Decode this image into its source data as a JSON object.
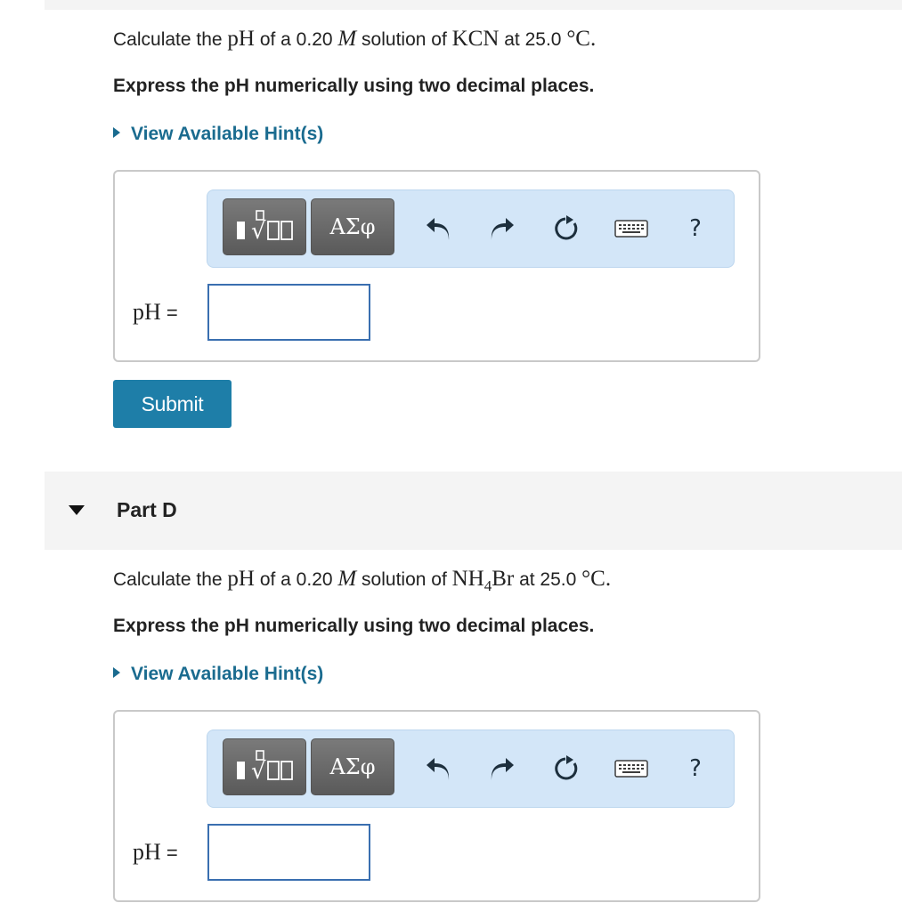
{
  "part_c": {
    "question": {
      "pre": "Calculate the ",
      "ph": "pH",
      "of_a": " of a 0.20 ",
      "M": "M",
      "solution_of": " solution of ",
      "compound": "KCN",
      "at": " at 25.0 ",
      "deg": "°C",
      "end": "."
    },
    "instruction": "Express the pH numerically using two decimal places.",
    "hint_label": "View Available Hint(s)",
    "toolbar": {
      "greek_label": "ΑΣφ",
      "help_label": "?"
    },
    "answer": {
      "label_var": "pH",
      "label_eq": " =",
      "value": ""
    },
    "submit_label": "Submit"
  },
  "part_d": {
    "title": "Part D",
    "question": {
      "pre": "Calculate the ",
      "ph": "pH",
      "of_a": " of a 0.20 ",
      "M": "M",
      "solution_of": " solution of ",
      "compound_a": "NH",
      "compound_sub": "4",
      "compound_b": "Br",
      "at": " at 25.0 ",
      "deg": "°C",
      "end": "."
    },
    "instruction": "Express the pH numerically using two decimal places.",
    "hint_label": "View Available Hint(s)",
    "toolbar": {
      "greek_label": "ΑΣφ",
      "help_label": "?"
    },
    "answer": {
      "label_var": "pH",
      "label_eq": " =",
      "value": ""
    }
  },
  "colors": {
    "link": "#1a6b8f",
    "submit_bg": "#1e7ea8",
    "toolbar_bg": "#d3e6f8",
    "input_border": "#3a6fb0"
  },
  "icons": [
    "templates-icon",
    "undo-icon",
    "redo-icon",
    "reset-icon",
    "keyboard-icon",
    "help-icon",
    "expand-triangle-icon"
  ]
}
